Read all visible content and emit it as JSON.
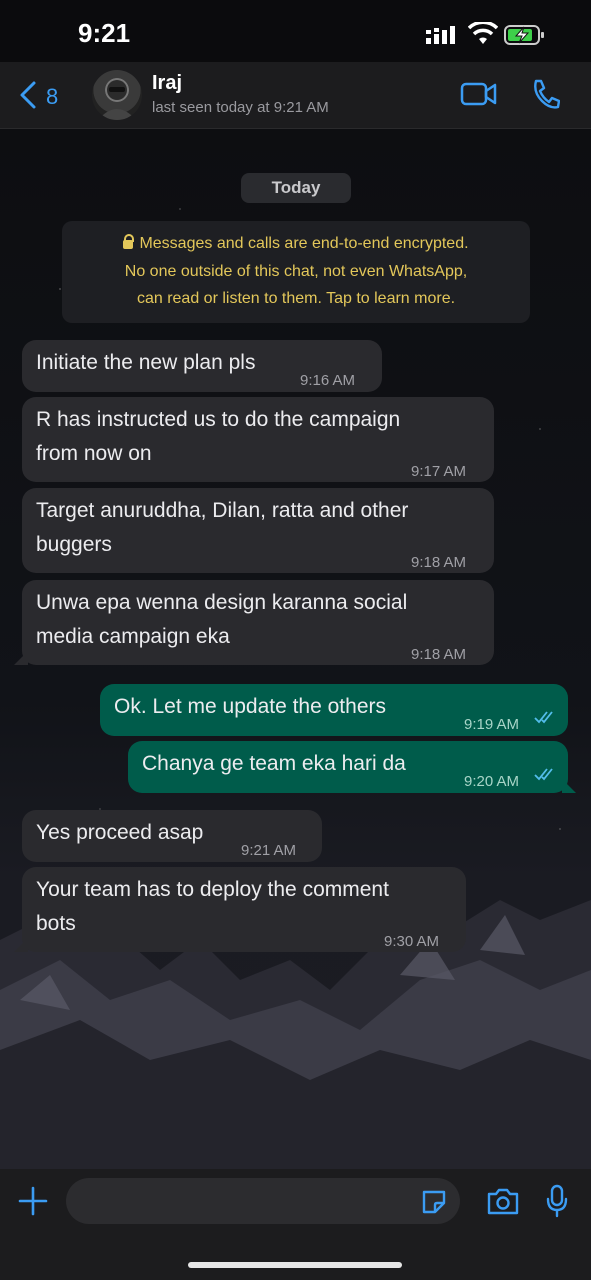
{
  "status_bar": {
    "time": "9:21"
  },
  "header": {
    "back_count": "8",
    "contact_name": "Iraj",
    "last_seen": "last seen today at 9:21 AM"
  },
  "chat": {
    "date_chip": "Today",
    "encryption_notice": {
      "line1": "Messages and calls are end-to-end encrypted.",
      "line2": "No one outside of this chat, not even WhatsApp,",
      "line3": "can read or listen to them. Tap to learn more."
    },
    "messages": [
      {
        "direction": "incoming",
        "lines": [
          "Initiate the new plan pls"
        ],
        "time": "9:16 AM"
      },
      {
        "direction": "incoming",
        "lines": [
          "R has instructed us to do the campaign",
          "from now on"
        ],
        "time": "9:17 AM"
      },
      {
        "direction": "incoming",
        "lines": [
          "Target anuruddha, Dilan, ratta and other",
          "buggers"
        ],
        "time": "9:18 AM"
      },
      {
        "direction": "incoming",
        "lines": [
          "Unwa epa wenna design karanna social",
          "media campaign eka"
        ],
        "time": "9:18 AM"
      },
      {
        "direction": "outgoing",
        "lines": [
          "Ok. Let me update the others"
        ],
        "time": "9:19 AM",
        "status": "read"
      },
      {
        "direction": "outgoing",
        "lines": [
          "Chanya ge team eka hari da"
        ],
        "time": "9:20 AM",
        "status": "read"
      },
      {
        "direction": "incoming",
        "lines": [
          "Yes proceed asap"
        ],
        "time": "9:21 AM"
      },
      {
        "direction": "incoming",
        "lines": [
          "Your team has to deploy the comment",
          "bots"
        ],
        "time": "9:30 AM"
      }
    ]
  },
  "input_bar": {
    "icons": [
      "plus-icon",
      "sticker-icon",
      "camera-icon",
      "microphone-icon"
    ]
  },
  "colors": {
    "accent": "#3b9cf3",
    "incoming_bubble": "#2a2a2e",
    "outgoing_bubble": "#005c4b",
    "encryption_text": "#e3c75a",
    "read_ticks": "#53bdeb"
  }
}
